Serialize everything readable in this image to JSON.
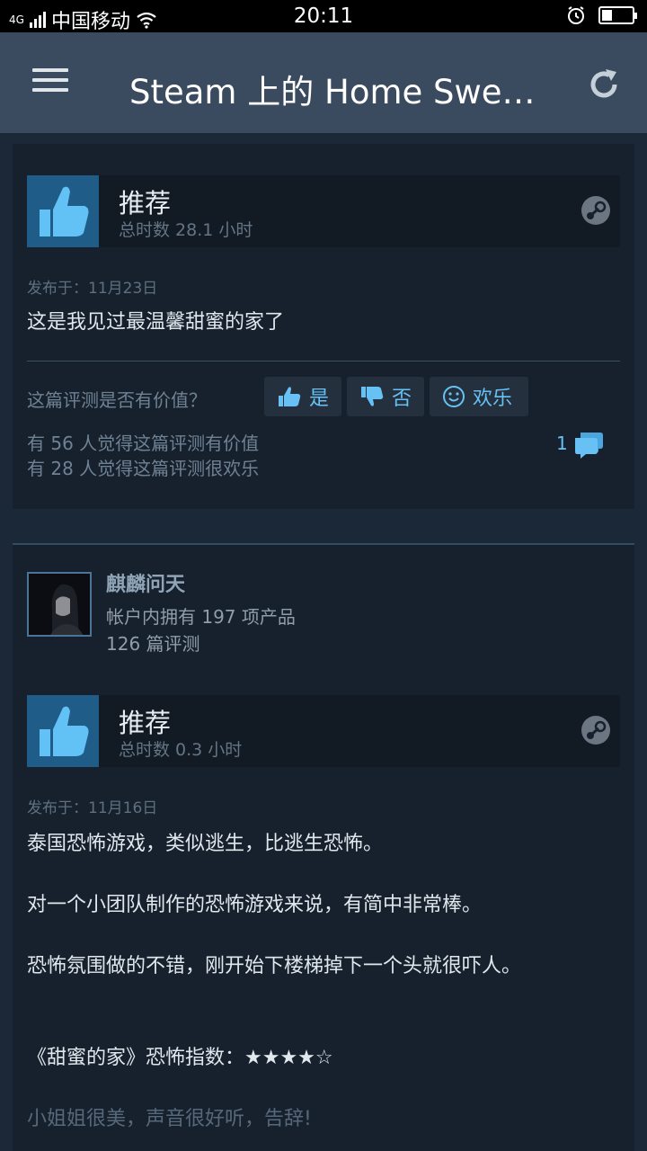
{
  "status_bar": {
    "network": "4G",
    "carrier": "中国移动",
    "time": "20:11",
    "battery_level": 0.35
  },
  "app_bar": {
    "title": "Steam 上的 Home Sweet Home",
    "menu_icon": "hamburger-icon",
    "refresh_icon": "refresh-icon"
  },
  "colors": {
    "background": "#1b2838",
    "appbar": "#3a4a5f",
    "accent": "#67c1f5",
    "thumb_bg": "#1f5c87"
  },
  "reviews": [
    {
      "recommendation": "推荐",
      "hours": "总时数 28.1 小时",
      "posted": "发布于：11月23日",
      "text": "这是我见过最温馨甜蜜的家了",
      "helpful_question": "这篇评测是否有价值？",
      "vote_yes": "是",
      "vote_no": "否",
      "vote_funny": "欢乐",
      "helpful_stat": "有 56 人觉得这篇评测有价值",
      "funny_stat": "有 28 人觉得这篇评测很欢乐",
      "comment_count": "1"
    },
    {
      "author": {
        "name": "麒麟问天",
        "products": "帐户内拥有 197 项产品",
        "reviews": "126 篇评测"
      },
      "recommendation": "推荐",
      "hours": "总时数 0.3 小时",
      "posted": "发布于：11月16日",
      "paragraphs": [
        "泰国恐怖游戏，类似逃生，比逃生恐怖。",
        "对一个小团队制作的恐怖游戏来说，有简中非常棒。",
        "恐怖氛围做的不错，刚开始下楼梯掉下一个头就很吓人。",
        "《甜蜜的家》恐怖指数：★★★★☆",
        "小姐姐很美，声音很好听，告辞!"
      ]
    }
  ]
}
